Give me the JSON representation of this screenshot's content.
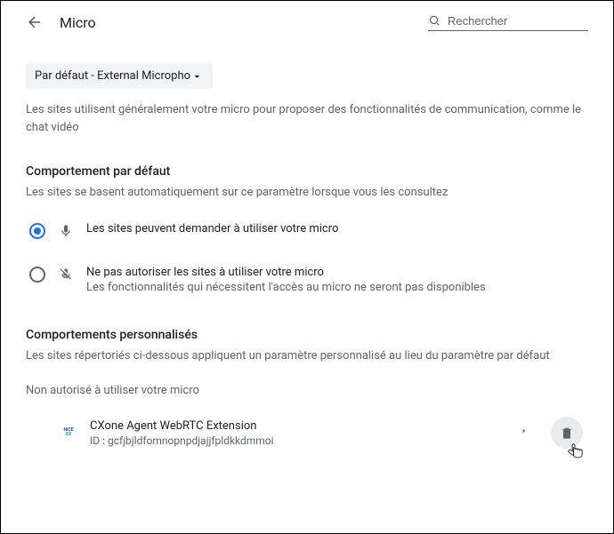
{
  "header": {
    "title": "Micro",
    "search_placeholder": "Rechercher"
  },
  "device": {
    "label": "Par défaut - External Microphone"
  },
  "description": "Les sites utilisent généralement votre micro pour proposer des fonctionnalités de communication, comme le chat vidéo",
  "default_behavior": {
    "heading": "Comportement par défaut",
    "sub": "Les sites se basent automatiquement sur ce paramètre lorsque vous les consultez",
    "options": [
      {
        "label": "Les sites peuvent demander à utiliser votre micro",
        "sub": "",
        "checked": true
      },
      {
        "label": "Ne pas autoriser les sites à utiliser votre micro",
        "sub": "Les fonctionnalités qui nécessitent l'accès au micro ne seront pas disponibles",
        "checked": false
      }
    ]
  },
  "custom": {
    "heading": "Comportements personnalisés",
    "sub": "Les sites répertoriés ci-dessous appliquent un paramètre personnalisé au lieu du paramètre par défaut",
    "blocked_label": "Non autorisé à utiliser votre micro",
    "sites": [
      {
        "name": "CXone Agent WebRTC Extension",
        "id": "ID : gcfjbjldfomnopnpdjajjfpldkkdmmoi"
      }
    ]
  }
}
